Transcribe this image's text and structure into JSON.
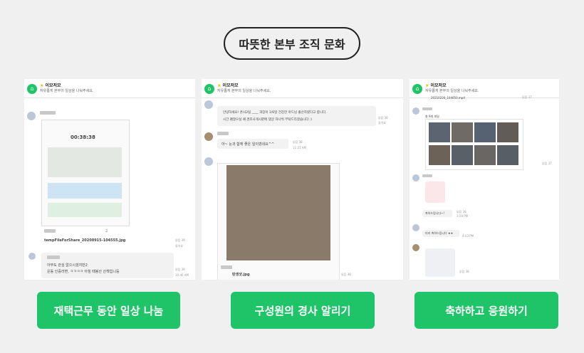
{
  "title": "따뜻한 본부 조직 문화",
  "buttons": [
    "재택근무 동안 일상 나눔",
    "구성원의 경사 알리기",
    "축하하고 응원하기"
  ],
  "channel": {
    "name": "이모저모",
    "desc": "자유롭게 본부의 일상을 나눠주세요."
  },
  "card1": {
    "time": "00:38:38",
    "file": "tempFileForShare_20200915-104555.jpg",
    "reply_count": "2",
    "read1": "읽음 39",
    "like": "좋아요",
    "reply_text_1": "아무도 관심 없으시겠지만2",
    "reply_text_2": "운동 인증라면, ㅋㅋㅋㅋ 아침 때봉산 산책입니둥",
    "read2": "읽음 39",
    "time2": "10:46 AM"
  },
  "card2": {
    "msg1": "안녕하세요! 존사2팀 ____ 과장이 1/6일 건강한 아드님 출산하였다고 합니다.",
    "msg1b": "시간 괜찮으실 때 경조사게시판에 댓글 하나씩 부탁드리겠습니다 :)",
    "read1": "읽음 38",
    "like1": "좋아요",
    "msg2": "아~ 눈과 함께 좋은 일이였네요^^",
    "read2": "읽음 38",
    "time2": "11:21 AM",
    "file": "탄생샷.jpg",
    "read3": "읽음 38"
  },
  "card3": {
    "file": "20210226_104050.mp4",
    "read0": "읽음 37",
    "read1": "읽음 37",
    "caption1": "총 9개 파일",
    "msg1": "축하드립니다~!",
    "read2": "읽음 38",
    "time2": "3:59 PM",
    "msg2": "미리 축하드립니다 ★★",
    "time3": "4:03 PM",
    "read3": "읽음 38"
  }
}
